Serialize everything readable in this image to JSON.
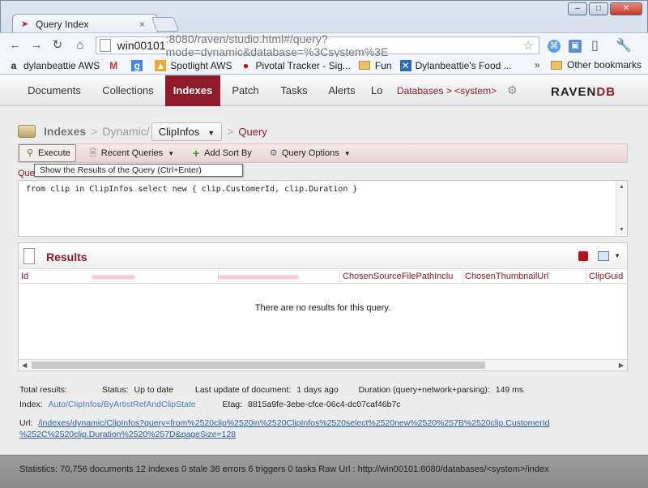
{
  "browser": {
    "tab_title": "Query Index",
    "url_host": "win00101",
    "url_rest": ":8080/raven/studio.html#/query?mode=dynamic&database=%3Csystem%3E",
    "bookmarks": [
      {
        "label": "dylanbeattie AWS",
        "icon": "amazon-icon"
      },
      {
        "label": "",
        "icon": "gmail-icon"
      },
      {
        "label": "",
        "icon": "google-icon"
      },
      {
        "label": "Spotlight AWS",
        "icon": "box-icon"
      },
      {
        "label": "Pivotal Tracker - Sig...",
        "icon": "pivotal-icon"
      },
      {
        "label": "Fun",
        "icon": "folder-icon"
      },
      {
        "label": "Dylanbeattie's Food ...",
        "icon": "fork-icon"
      }
    ],
    "bookmarks_more": "»",
    "other_bookmarks": "Other bookmarks"
  },
  "nav": {
    "items": [
      "Documents",
      "Collections",
      "Indexes",
      "Patch",
      "Tasks",
      "Alerts",
      "Lo"
    ],
    "active": "Indexes",
    "databases_label": "Databases >",
    "database_name": "<system>",
    "logo_text_a": "RAVEN",
    "logo_text_b": "DB"
  },
  "breadcrumb": {
    "indexes": "Indexes",
    "dynamic": "Dynamic/",
    "collection": "ClipInfos",
    "query": "Query"
  },
  "toolbar": {
    "execute": "Execute",
    "recent": "Recent Queries",
    "add_sort": "Add Sort By",
    "options": "Query Options"
  },
  "tooltip": "Show the Results of the Query (Ctrl+Enter)",
  "query_label": "Quer",
  "query_text": "from clip in ClipInfos select new { clip.CustomerId, clip.Duration }",
  "results": {
    "title": "Results",
    "columns": [
      "Id",
      "ChosenSourceFilePathInclu",
      "ChosenThumbnailUrl",
      "ClipGuid"
    ],
    "empty_message": "There are no results for this query."
  },
  "info": {
    "total_results": "Total results:",
    "status_label": "Status:",
    "status_value": "Up to date",
    "last_update_label": "Last update of document:",
    "last_update_value": "1 days ago",
    "duration_label": "Duration (query+network+parsing):",
    "duration_value": "149 ms",
    "index_label": "Index:",
    "index_value": "Auto/ClipInfos/ByArtistRefAndClipState",
    "etag_label": "Etag:",
    "etag_value": "8815a9fe-3ebe-cfce-06c4-dc07caf46b7c",
    "url_label": "Url:",
    "url_line1": "/indexes/dynamic/ClipInfos?query=from%2520clip%2520in%2520ClipInfos%2520select%2520new%2520%257B%2520clip.CustomerId",
    "url_line2": "%252C%2520clip.Duration%2520%257D&pageSize=128"
  },
  "statusbar": {
    "text": "Statistics:   70,756 documents   12 indexes   0 stale   36 errors   6 triggers   0 tasks   Raw Url : http://win00101:8080/databases/<system>/index"
  }
}
